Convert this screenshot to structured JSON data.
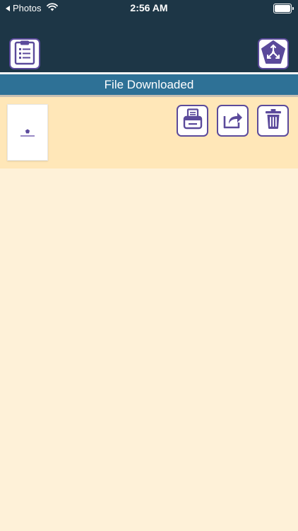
{
  "status_bar": {
    "back_app": "Photos",
    "time": "2:56 AM"
  },
  "header": {
    "title": "File Downloaded"
  },
  "toolbar": {
    "left_icon": "clipboard-list-icon",
    "right_icon": "app-logo-icon"
  },
  "files": [
    {
      "thumbnail": "document-thumbnail",
      "actions": [
        "print-icon",
        "share-icon",
        "trash-icon"
      ]
    }
  ],
  "colors": {
    "header_bg": "#1d3646",
    "title_bar_bg": "#2e7196",
    "accent_purple": "#5b4a9b",
    "row_bg": "#ffe7b8",
    "page_bg": "#fef1d8"
  }
}
